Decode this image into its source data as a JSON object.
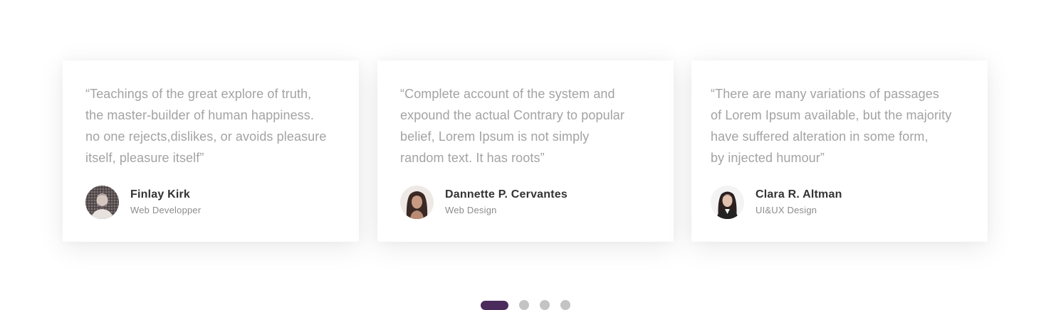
{
  "testimonials": [
    {
      "quote": "“Teachings of the great explore of truth,\nthe master-builder of human happiness.\nno one rejects,dislikes, or avoids pleasure\nitself, pleasure itself”",
      "name": "Finlay Kirk",
      "role": "Web Developper"
    },
    {
      "quote": "“Complete account of the system and\nexpound the actual Contrary to popular\nbelief, Lorem Ipsum is not simply\nrandom text. It has roots”",
      "name": "Dannette P. Cervantes",
      "role": "Web Design"
    },
    {
      "quote": "“There are many variations of passages\n of Lorem Ipsum available, but the majority\n have suffered alteration in some form,\n by injected humour”",
      "name": "Clara R. Altman",
      "role": "UI&UX Design"
    }
  ],
  "pagination": {
    "total": 4,
    "active_index": 0
  },
  "colors": {
    "accent": "#4b2a5c",
    "dot_inactive": "#c4c4c4",
    "quote_text": "#a3a3a3",
    "name_text": "#333333",
    "role_text": "#8c8c8c"
  }
}
